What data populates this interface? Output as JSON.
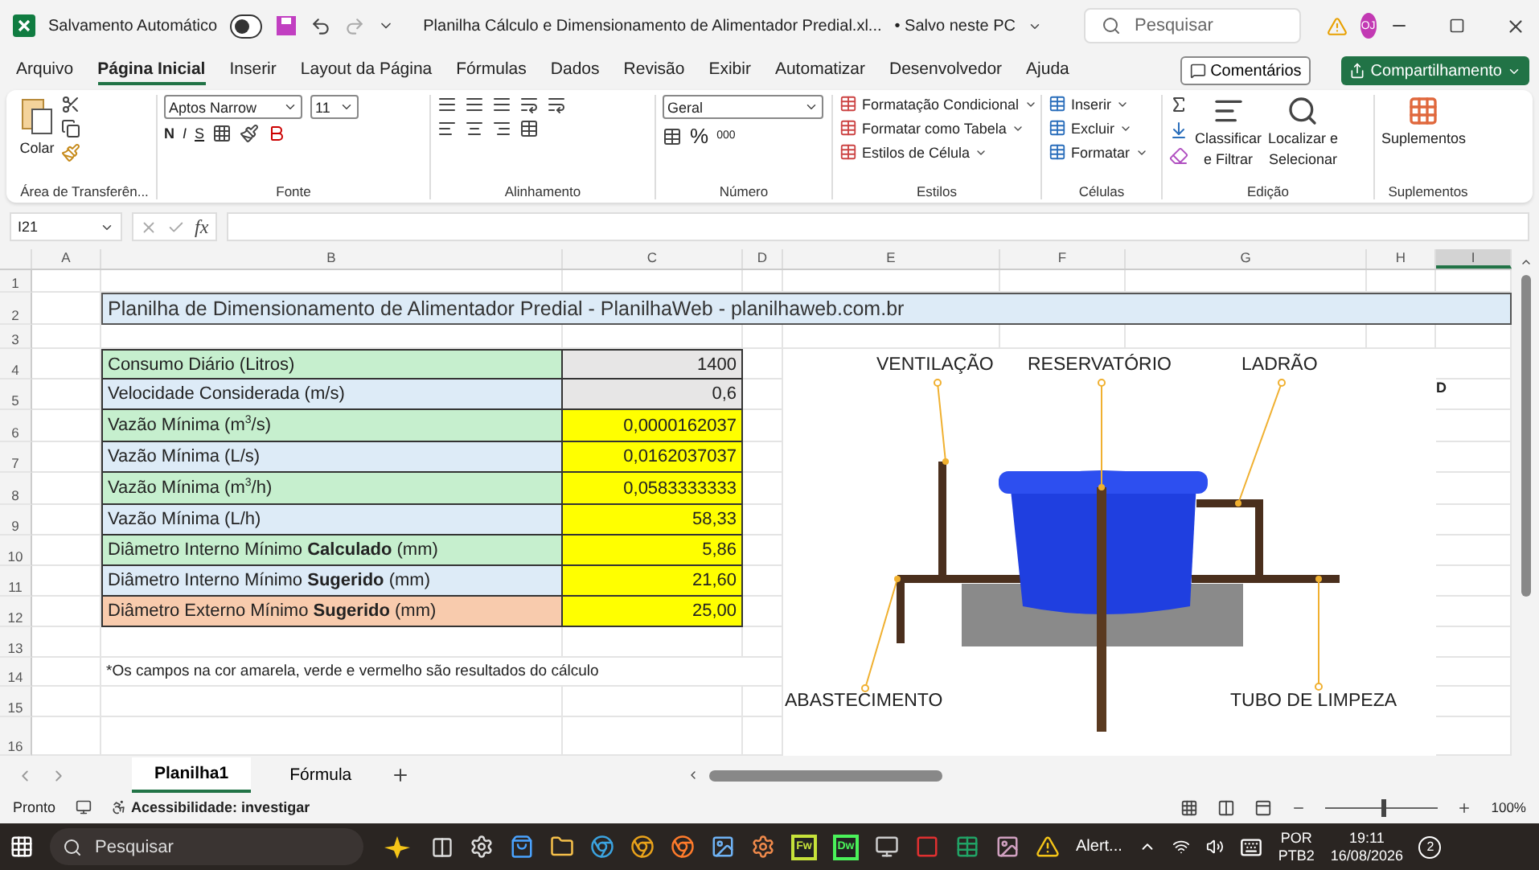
{
  "title_bar": {
    "autosave_label": "Salvamento Automático",
    "autosave_on": false,
    "document_title": "Planilha Cálculo e Dimensionamento de Alimentador Predial.xl...",
    "save_status": "• Salvo neste PC",
    "search_placeholder": "Pesquisar",
    "avatar_initials": "OJ"
  },
  "menu_tabs": [
    {
      "label": "Arquivo",
      "selected": false
    },
    {
      "label": "Página Inicial",
      "selected": true
    },
    {
      "label": "Inserir",
      "selected": false
    },
    {
      "label": "Layout da Página",
      "selected": false
    },
    {
      "label": "Fórmulas",
      "selected": false
    },
    {
      "label": "Dados",
      "selected": false
    },
    {
      "label": "Revisão",
      "selected": false
    },
    {
      "label": "Exibir",
      "selected": false
    },
    {
      "label": "Automatizar",
      "selected": false
    },
    {
      "label": "Desenvolvedor",
      "selected": false
    },
    {
      "label": "Ajuda",
      "selected": false
    }
  ],
  "comments_button": "Comentários",
  "share_button": "Compartilhamento",
  "ribbon": {
    "clipboard": {
      "paste": "Colar",
      "label": "Área de Transferên..."
    },
    "font": {
      "font_name": "Aptos Narrow",
      "font_size": "11",
      "bold": "N",
      "italic": "I",
      "underline": "S",
      "label": "Fonte"
    },
    "alignment": {
      "label": "Alinhamento"
    },
    "number": {
      "format": "Geral",
      "percent": "%",
      "thousands": "000",
      "label": "Número"
    },
    "styles": {
      "items": [
        "Formatação Condicional",
        "Formatar como Tabela",
        "Estilos de Célula"
      ],
      "label": "Estilos"
    },
    "cells": {
      "items": [
        "Inserir",
        "Excluir",
        "Formatar"
      ],
      "label": "Células"
    },
    "editing": {
      "sort": [
        "Classificar",
        "e Filtrar"
      ],
      "find": [
        "Localizar e",
        "Selecionar"
      ],
      "label": "Edição"
    },
    "addins": {
      "button": "Suplementos",
      "label": "Suplementos"
    }
  },
  "formula_bar": {
    "name_box": "I21",
    "fx": "fx"
  },
  "sheet": {
    "columns": [
      {
        "label": "A",
        "selected": false
      },
      {
        "label": "B",
        "selected": false
      },
      {
        "label": "C",
        "selected": false
      },
      {
        "label": "D",
        "selected": false
      },
      {
        "label": "E",
        "selected": false
      },
      {
        "label": "F",
        "selected": false
      },
      {
        "label": "G",
        "selected": false
      },
      {
        "label": "H",
        "selected": false
      },
      {
        "label": "I",
        "selected": true
      }
    ],
    "row_numbers": [
      "1",
      "2",
      "3",
      "4",
      "5",
      "6",
      "7",
      "8",
      "9",
      "10",
      "11",
      "12",
      "13",
      "14",
      "15",
      "16"
    ],
    "title": "Planilha de Dimensionamento de Alimentador Predial - PlanilhaWeb - planilhaweb.com.br",
    "table": [
      {
        "label": "Consumo Diário (Litros)",
        "value": "1400",
        "color": "#c6efce",
        "kind": "input"
      },
      {
        "label": "Velocidade Considerada (m/s)",
        "value": "0,6",
        "color": "#ddebf7",
        "kind": "input"
      },
      {
        "label": "Vazão Mínima (m$^{3}$/s)",
        "value": "0,0000162037",
        "color": "#c6efce",
        "kind": "result"
      },
      {
        "label": "Vazão Mínima (L/s)",
        "value": "0,0162037037",
        "color": "#ddebf7",
        "kind": "result"
      },
      {
        "label": "Vazão Mínima (m$^{3}$/h)",
        "value": "0,0583333333",
        "color": "#c6efce",
        "kind": "result"
      },
      {
        "label": "Vazão Mínima (L/h)",
        "value": "58,33",
        "color": "#ddebf7",
        "kind": "result"
      },
      {
        "label": "Diâmetro Interno Mínimo **Calculado** (mm)",
        "value": "5,86",
        "color": "#c6efce",
        "kind": "result"
      },
      {
        "label": "Diâmetro Interno Mínimo **Sugerido** (mm)",
        "value": "21,60",
        "color": "#ddebf7",
        "kind": "result"
      },
      {
        "label": "Diâmetro Externo Mínimo **Sugerido** (mm)",
        "value": "25,00",
        "color": "#f8cbad",
        "kind": "result"
      }
    ],
    "note": "*Os campos na cor amarela, verde e vermelho são resultados do cálculo",
    "column_i_text": "D",
    "diagram": {
      "labels": [
        "VENTILAÇÃO",
        "RESERVATÓRIO",
        "LADRÃO",
        "ABASTECIMENTO",
        "TUBO DE LIMPEZA"
      ]
    }
  },
  "sheet_tabs": [
    {
      "label": "Planilha1",
      "selected": true
    },
    {
      "label": "Fórmula",
      "selected": false
    }
  ],
  "status_bar": {
    "ready": "Pronto",
    "accessibility": "Acessibilidade: investigar",
    "zoom": "100%",
    "zoom_slider": {
      "level": 0.5
    }
  },
  "taskbar": {
    "search_placeholder": "Pesquisar",
    "app_labels": [
      "Fw",
      "Dw"
    ],
    "alert": "Alert...",
    "language": [
      "POR",
      "PTB2"
    ],
    "time": "19:11",
    "date": "16/08/2026",
    "notifications": "2"
  }
}
